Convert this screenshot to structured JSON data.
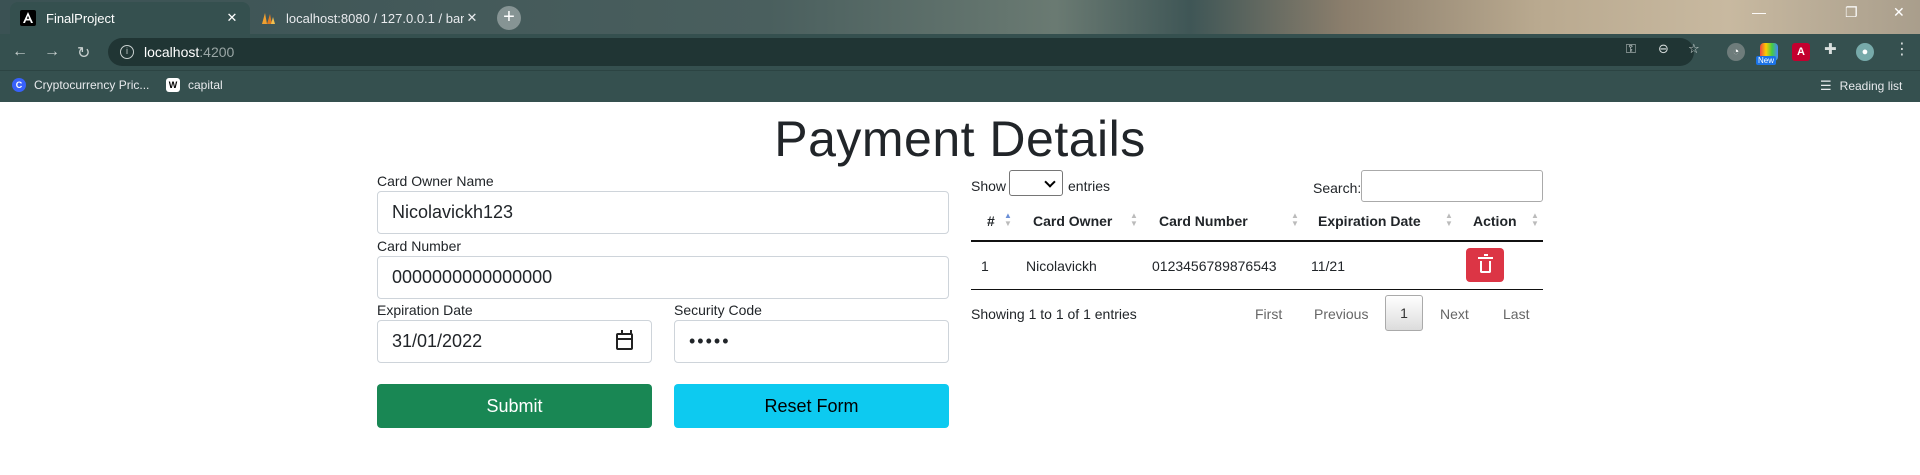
{
  "browser": {
    "tabs": [
      {
        "title": "FinalProject",
        "favicon": "angular-logo-icon"
      },
      {
        "title": "localhost:8080 / 127.0.0.1 / banl",
        "favicon": "phpmyadmin-icon"
      }
    ],
    "address": {
      "host": "localhost",
      "port": ":4200"
    },
    "bookmarks": [
      {
        "label": "Cryptocurrency Pric...",
        "icon": "coinmarketcap-icon"
      },
      {
        "label": "capital",
        "icon": "wikipedia-icon"
      }
    ],
    "reading_list": "Reading list",
    "ext_badge": "New"
  },
  "page": {
    "title": "Payment Details"
  },
  "form": {
    "owner": {
      "label": "Card Owner Name",
      "value": "Nicolavickh123"
    },
    "card_number": {
      "label": "Card Number",
      "value": "0000000000000000"
    },
    "expiration": {
      "label": "Expiration Date",
      "value": "31/01/2022"
    },
    "security": {
      "label": "Security Code",
      "value": "•••••"
    },
    "submit_label": "Submit",
    "reset_label": "Reset Form"
  },
  "table": {
    "show_label": "Show",
    "entries_label": "entries",
    "search_label": "Search:",
    "columns": [
      "#",
      "Card Owner",
      "Card Number",
      "Expiration Date",
      "Action"
    ],
    "rows": [
      {
        "id": "1",
        "owner": "Nicolavickh",
        "number": "0123456789876543",
        "expiration": "11/21"
      }
    ],
    "info": "Showing 1 to 1 of 1 entries",
    "pagination": {
      "first": "First",
      "previous": "Previous",
      "current": "1",
      "next": "Next",
      "last": "Last"
    }
  }
}
